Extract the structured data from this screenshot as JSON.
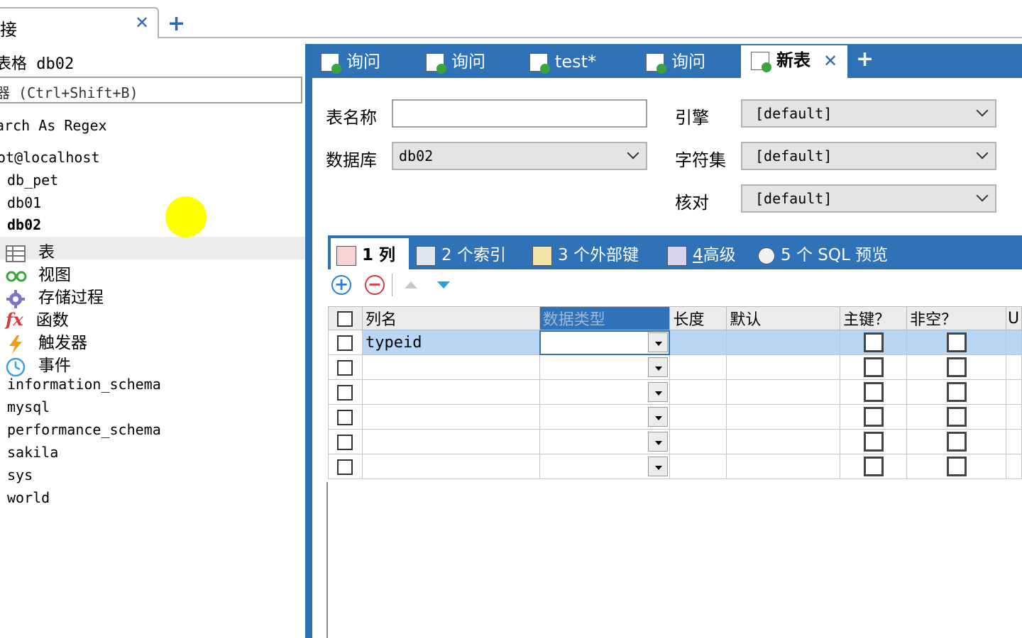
{
  "connection_tab": {
    "label": "接",
    "close": "✕",
    "add": "+"
  },
  "left_panel": {
    "header": "表格 db02",
    "search_placeholder": "器 (Ctrl+Shift+B)",
    "regex_label": "arch As Regex",
    "server": "ot@localhost",
    "databases": [
      "db_pet",
      "db01",
      "db02"
    ],
    "db02_children": [
      {
        "label": "表",
        "icon": "table-icon"
      },
      {
        "label": "视图",
        "icon": "view-icon"
      },
      {
        "label": "存储过程",
        "icon": "gear-icon"
      },
      {
        "label": "函数",
        "icon": "function-icon"
      },
      {
        "label": "触发器",
        "icon": "lightning-icon"
      },
      {
        "label": "事件",
        "icon": "clock-icon"
      }
    ],
    "other_databases": [
      "information_schema",
      "mysql",
      "performance_schema",
      "sakila",
      "sys",
      "world"
    ]
  },
  "doc_tabs": [
    {
      "label": "询问",
      "icon": "query-icon"
    },
    {
      "label": "询问",
      "icon": "query-icon"
    },
    {
      "label": "test*",
      "icon": "table-edit-icon"
    },
    {
      "label": "询问",
      "icon": "query-icon"
    },
    {
      "label": "新表",
      "icon": "new-table-icon",
      "active": true
    }
  ],
  "doc_tab_close": "✕",
  "doc_tab_add": "+",
  "form": {
    "table_name_label": "表名称",
    "table_name_value": "",
    "database_label": "数据库",
    "database_value": "db02",
    "engine_label": "引擎",
    "engine_value": "[default]",
    "charset_label": "字符集",
    "charset_value": "[default]",
    "collation_label": "核对",
    "collation_value": "[default]"
  },
  "sub_tabs": [
    {
      "num": "1",
      "label": "列"
    },
    {
      "num": "2",
      "label": "个索引"
    },
    {
      "num": "3",
      "label": "个外部键"
    },
    {
      "num": "4",
      "label": "高级"
    },
    {
      "num": "5",
      "label": "个 SQL 预览"
    }
  ],
  "grid": {
    "headers": [
      "列名",
      "数据类型",
      "长度",
      "默认",
      "主键？",
      "非空？",
      "U"
    ],
    "rows": [
      {
        "name": "typeid"
      },
      {
        "name": ""
      },
      {
        "name": ""
      },
      {
        "name": ""
      },
      {
        "name": ""
      },
      {
        "name": ""
      }
    ]
  },
  "colors": {
    "accent": "#2f72b8",
    "highlight": "#b9d7f4",
    "cursor": "#ffff00"
  }
}
